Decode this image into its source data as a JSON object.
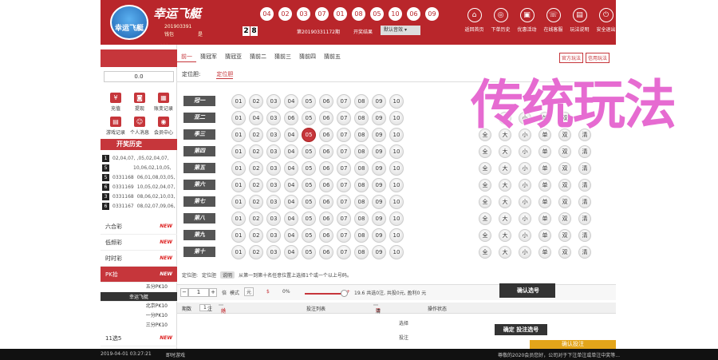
{
  "header": {
    "logo_text": "幸运飞艇",
    "brand": "幸运飞艇",
    "user_id": "201903391",
    "user_label": "钱包",
    "user_extra": "是",
    "user_id_2": "201",
    "top_balls": [
      "04",
      "02",
      "03",
      "07",
      "01",
      "08",
      "05",
      "10",
      "06",
      "09"
    ],
    "countdown": [
      "2",
      "8"
    ],
    "issue_text": "第20190331172期",
    "result_text": "开奖结果",
    "sound": "默认音效",
    "nav": [
      {
        "icon": "⌂",
        "label": "返回首页"
      },
      {
        "icon": "◎",
        "label": "下单历史"
      },
      {
        "icon": "▣",
        "label": "优惠活动"
      },
      {
        "icon": "☏",
        "label": "在线客服"
      },
      {
        "icon": "▤",
        "label": "玩法说明"
      },
      {
        "icon": "⏻",
        "label": "安全退出"
      }
    ]
  },
  "sidebar": {
    "balance": "0.0",
    "icons": [
      {
        "icon": "¥",
        "label": "充值"
      },
      {
        "icon": "◙",
        "label": "提现"
      },
      {
        "icon": "▦",
        "label": "账变记录"
      },
      {
        "icon": "▤",
        "label": "游戏记录"
      },
      {
        "icon": "☺",
        "label": "个人消息"
      },
      {
        "icon": "◉",
        "label": "会员中心"
      }
    ],
    "history_title": "开奖历史",
    "history": [
      {
        "rank": "1",
        "issue": "",
        "nums": "02,04,07,  ,05,02,04,07,"
      },
      {
        "rank": "5",
        "issue": "",
        "nums": "10,06,02,10,05,"
      },
      {
        "rank": "5",
        "issue": "0331168",
        "nums": "06,01,08,03,05,"
      },
      {
        "rank": "6",
        "issue": "0331169",
        "nums": "10,05,02,04,07,"
      },
      {
        "rank": "3",
        "issue": "0331168",
        "nums": "08,06,02,10,03,"
      },
      {
        "rank": "6",
        "issue": "0331167",
        "nums": "08,02,07,09,06,"
      }
    ],
    "lotteries": [
      {
        "name": "六合彩",
        "badge": "NEW"
      },
      {
        "name": "低频彩",
        "badge": "NEW"
      },
      {
        "name": "时时彩",
        "badge": "NEW"
      },
      {
        "name": "PK拾",
        "badge": "NEW"
      }
    ],
    "pk_sub": [
      "五分PK10",
      "幸运飞艇",
      "北京PK10",
      "一分PK10",
      "三分PK10"
    ],
    "last_lottery": {
      "name": "11选5",
      "badge": "NEW"
    }
  },
  "main": {
    "tabs": [
      "前一",
      "猜冠军",
      "猜冠亚",
      "猜前二",
      "猜前三",
      "猜前四",
      "猜前五"
    ],
    "tabs_right": [
      "官方玩法",
      "信用玩法"
    ],
    "subtabs": [
      "定位胆:",
      "定位胆"
    ],
    "row_labels": [
      "冠一",
      "亚二",
      "季三",
      "第四",
      "第五",
      "第六",
      "第七",
      "第八",
      "第九",
      "第十"
    ],
    "numbers": [
      "01",
      "02",
      "03",
      "04",
      "05",
      "06",
      "07",
      "08",
      "09",
      "10"
    ],
    "row2_numbers": [
      "01",
      "04",
      "03",
      "06",
      "05",
      "06",
      "07",
      "08",
      "09",
      "10"
    ],
    "options": [
      "全",
      "大",
      "小",
      "单",
      "双",
      "清"
    ],
    "rule_label": "定位胆:",
    "rule_name": "定位胆",
    "rule_badge": "说明",
    "rule_text": "从第一到第十名任意位置上选择1个或一个以上号码。",
    "stepper_value": "1",
    "multiple_label": "倍",
    "mode_label": "模式",
    "mode_value": "元",
    "currency": "$",
    "rebate": "0%",
    "odds_text": "19.6 共选0注, 共投0元, 盈利0 元",
    "confirm_label": "确认选号",
    "table_head": {
      "periods": "期数",
      "count": "1",
      "unit": "注",
      "shuffle": "随机",
      "list": "投注列表",
      "clear": "清空",
      "status": "操作状态"
    },
    "footer": {
      "select": "选择",
      "bet": "投注",
      "btn_dark": "确定 投注选号",
      "btn_gold": "确认投注"
    },
    "overlay_text": "传统玩法"
  },
  "status_bar": {
    "time": "2019-04-01 03:27:21",
    "mode": "即时游戏",
    "notice": "尊敬的2020会员您好，公司对于下注单注或单注中奖等..."
  }
}
